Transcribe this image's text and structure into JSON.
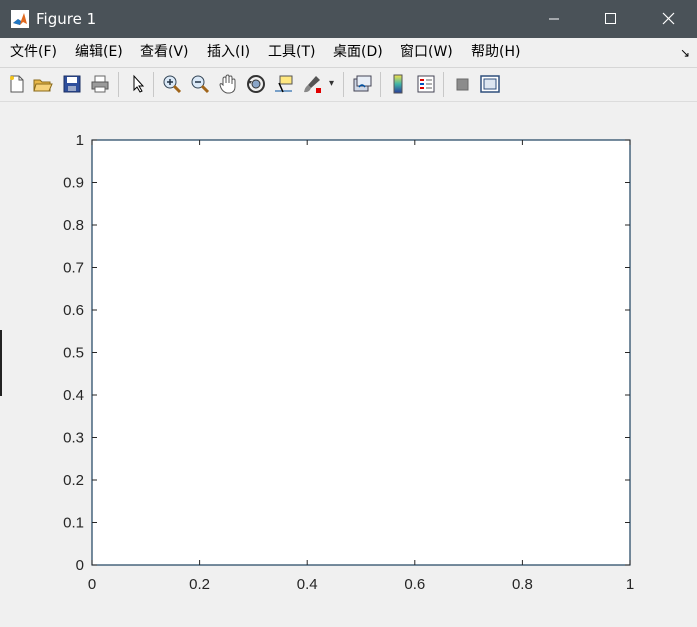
{
  "window": {
    "title": "Figure 1"
  },
  "menu": [
    {
      "label": "文件(F)"
    },
    {
      "label": "编辑(E)"
    },
    {
      "label": "查看(V)"
    },
    {
      "label": "插入(I)"
    },
    {
      "label": "工具(T)"
    },
    {
      "label": "桌面(D)"
    },
    {
      "label": "窗口(W)"
    },
    {
      "label": "帮助(H)"
    }
  ],
  "toolbar_icons": [
    "new-figure-icon",
    "open-file-icon",
    "save-icon",
    "print-icon",
    "edit-plot-icon",
    "zoom-in-icon",
    "zoom-out-icon",
    "pan-icon",
    "rotate-3d-icon",
    "data-cursor-icon",
    "brush-icon",
    "link-plot-icon",
    "insert-colorbar-icon",
    "insert-legend-icon",
    "hide-plot-tools-icon",
    "show-plot-tools-icon"
  ],
  "chart_data": {
    "type": "line",
    "series": [],
    "xlim": [
      0,
      1
    ],
    "ylim": [
      0,
      1
    ],
    "xticks": [
      "0",
      "0.2",
      "0.4",
      "0.6",
      "0.8",
      "1"
    ],
    "yticks": [
      "0",
      "0.1",
      "0.2",
      "0.3",
      "0.4",
      "0.5",
      "0.6",
      "0.7",
      "0.8",
      "0.9",
      "1"
    ],
    "grid": false,
    "title": "",
    "xlabel": "",
    "ylabel": ""
  },
  "colors": {
    "titlebar": "#4a5258",
    "axes": "#1c3f5e",
    "figure_bg": "#f0f0f0"
  }
}
